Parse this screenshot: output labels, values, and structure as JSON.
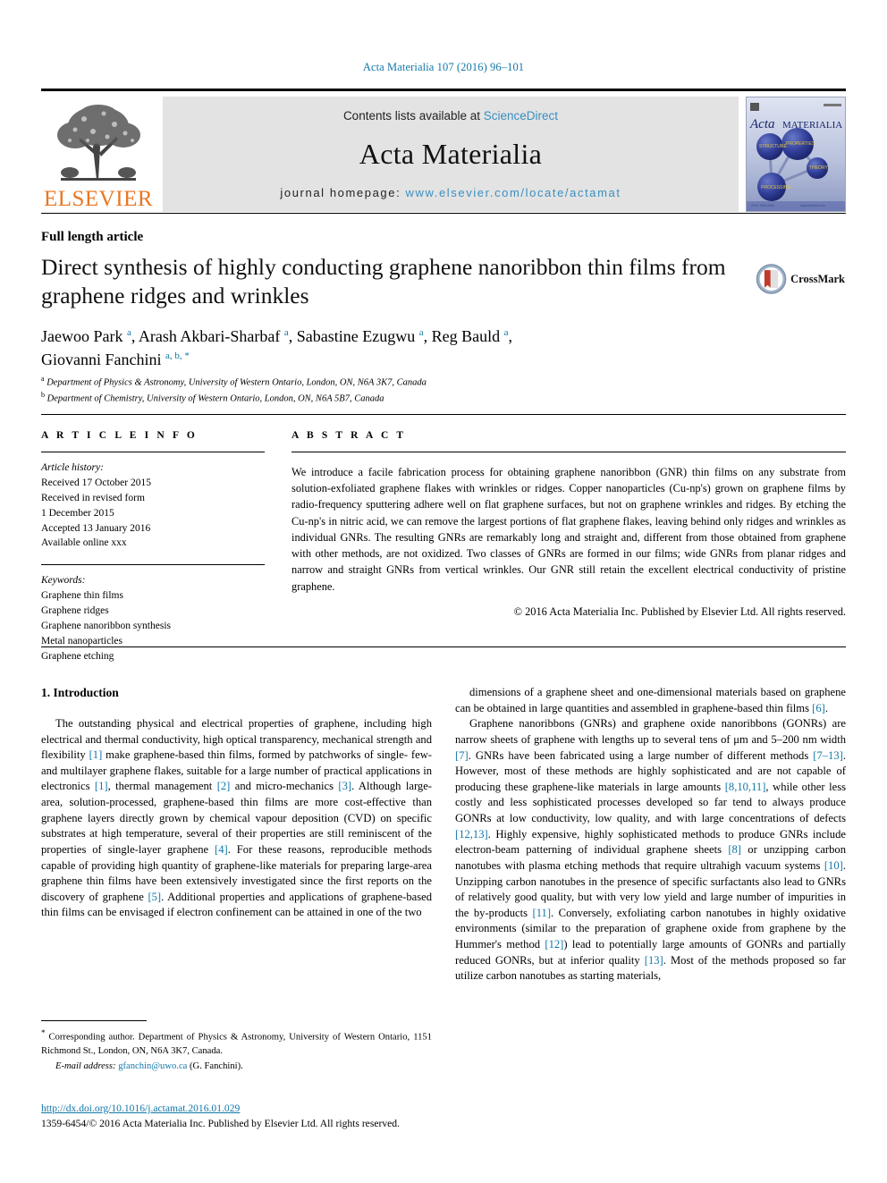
{
  "running_head": "Acta Materialia 107 (2016) 96–101",
  "masthead": {
    "publisher": "ELSEVIER",
    "contents_prefix": "Contents lists available at ",
    "contents_link": "ScienceDirect",
    "journal_title": "Acta Materialia",
    "homepage_prefix": "journal homepage: ",
    "homepage_url": "www.elsevier.com/locate/actamat",
    "cover_title_italic": "Acta",
    "cover_title_rest": "MATERIALIA",
    "accent_link_color": "#3a8fc0",
    "elsevier_orange": "#e87722"
  },
  "article": {
    "type": "Full length article",
    "title": "Direct synthesis of highly conducting graphene nanoribbon thin films from graphene ridges and wrinkles",
    "crossmark_label": "CrossMark",
    "authors_line1": "Jaewoo Park <sup>a</sup>, Arash Akbari-Sharbaf <sup>a</sup>, Sabastine Ezugwu <sup>a</sup>, Reg Bauld <sup>a</sup>,",
    "authors_line2": "Giovanni Fanchini <sup>a, b, *</sup>",
    "affiliation_a": "<sup>a</sup> Department of Physics &amp; Astronomy, University of Western Ontario, London, ON, N6A 3K7, Canada",
    "affiliation_b": "<sup>b</sup> Department of Chemistry, University of Western Ontario, London, ON, N6A 5B7, Canada"
  },
  "article_info": {
    "heading": "A R T I C L E   I N F O",
    "history_title": "Article history:",
    "history": [
      "Received 17 October 2015",
      "Received in revised form",
      "1 December 2015",
      "Accepted 13 January 2016",
      "Available online xxx"
    ],
    "keywords_title": "Keywords:",
    "keywords": [
      "Graphene thin films",
      "Graphene ridges",
      "Graphene nanoribbon synthesis",
      "Metal nanoparticles",
      "Graphene etching"
    ]
  },
  "abstract": {
    "heading": "A B S T R A C T",
    "text": "We introduce a facile fabrication process for obtaining graphene nanoribbon (GNR) thin films on any substrate from solution-exfoliated graphene flakes with wrinkles or ridges. Copper nanoparticles (Cu-np's) grown on graphene films by radio-frequency sputtering adhere well on flat graphene surfaces, but not on graphene wrinkles and ridges. By etching the Cu-np's in nitric acid, we can remove the largest portions of flat graphene flakes, leaving behind only ridges and wrinkles as individual GNRs. The resulting GNRs are remarkably long and straight and, different from those obtained from graphene with other methods, are not oxidized. Two classes of GNRs are formed in our films; wide GNRs from planar ridges and narrow and straight GNRs from vertical wrinkles. Our GNR still retain the excellent electrical conductivity of pristine graphene.",
    "copyright": "© 2016 Acta Materialia Inc. Published by Elsevier Ltd. All rights reserved."
  },
  "body": {
    "section_title": "1. Introduction",
    "left_paragraph_1": "The outstanding physical and electrical properties of graphene, including high electrical and thermal conductivity, high optical transparency, mechanical strength and flexibility <span class=\"ref\">[1]</span> make graphene-based thin films, formed by patchworks of single- few- and multilayer graphene flakes, suitable for a large number of practical applications in electronics <span class=\"ref\">[1]</span>, thermal management <span class=\"ref\">[2]</span> and micro-mechanics <span class=\"ref\">[3]</span>. Although large-area, solution-processed, graphene-based thin films are more cost-effective than graphene layers directly grown by chemical vapour deposition (CVD) on specific substrates at high temperature, several of their properties are still reminiscent of the properties of single-layer graphene <span class=\"ref\">[4]</span>. For these reasons, reproducible methods capable of providing high quantity of graphene-like materials for preparing large-area graphene thin films have been extensively investigated since the first reports on the discovery of graphene <span class=\"ref\">[5]</span>. Additional properties and applications of graphene-based thin films can be envisaged if electron confinement can be attained in one of the two",
    "right_paragraph_1": "dimensions of a graphene sheet and one-dimensional materials based on graphene can be obtained in large quantities and assembled in graphene-based thin films <span class=\"ref\">[6]</span>.",
    "right_paragraph_2": "Graphene nanoribbons (GNRs) and graphene oxide nanoribbons (GONRs) are narrow sheets of graphene with lengths up to several tens of μm and 5–200 nm width <span class=\"ref\">[7]</span>. GNRs have been fabricated using a large number of different methods <span class=\"ref\">[7–13]</span>. However, most of these methods are highly sophisticated and are not capable of producing these graphene-like materials in large amounts <span class=\"ref\">[8,10,11]</span>, while other less costly and less sophisticated processes developed so far tend to always produce GONRs at low conductivity, low quality, and with large concentrations of defects <span class=\"ref\">[12,13]</span>. Highly expensive, highly sophisticated methods to produce GNRs include electron-beam patterning of individual graphene sheets <span class=\"ref\">[8]</span> or unzipping carbon nanotubes with plasma etching methods that require ultrahigh vacuum systems <span class=\"ref\">[10]</span>. Unzipping carbon nanotubes in the presence of specific surfactants also lead to GNRs of relatively good quality, but with very low yield and large number of impurities in the by-products <span class=\"ref\">[11]</span>. Conversely, exfoliating carbon nanotubes in highly oxidative environments (similar to the preparation of graphene oxide from graphene by the Hummer's method <span class=\"ref\">[12]</span>) lead to potentially large amounts of GONRs and partially reduced GONRs, but at inferior quality <span class=\"ref\">[13]</span>. Most of the methods proposed so far utilize carbon nanotubes as starting materials,"
  },
  "footer": {
    "corresponding_note": "<span class=\"star\">*</span> Corresponding author. Department of Physics &amp; Astronomy, University of Western Ontario, 1151 Richmond St., London, ON, N6A 3K7, Canada.",
    "email_label": "E-mail address:",
    "email_address": "gfanchin@uwo.ca",
    "email_owner": "(G. Fanchini).",
    "doi_url": "http://dx.doi.org/10.1016/j.actamat.2016.01.029",
    "issn_line": "1359-6454/© 2016 Acta Materialia Inc. Published by Elsevier Ltd. All rights reserved."
  }
}
